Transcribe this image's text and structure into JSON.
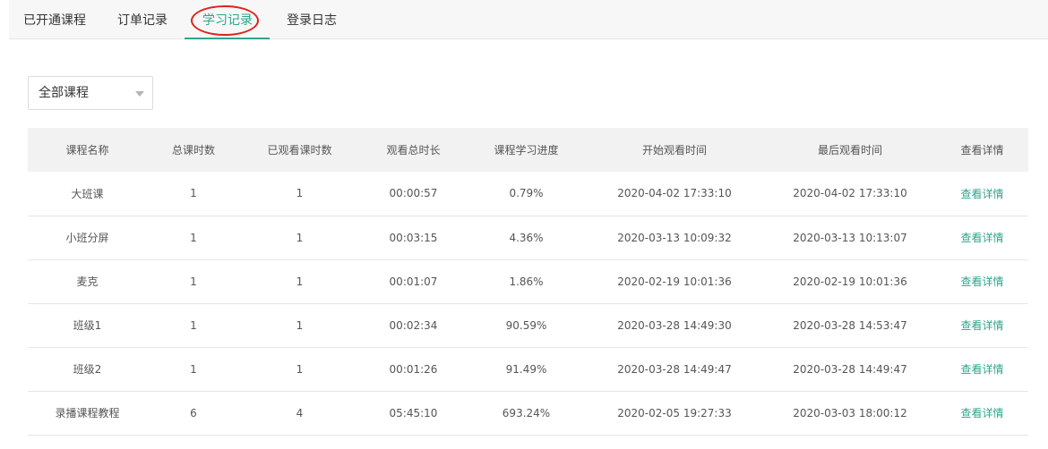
{
  "tabs": [
    {
      "label": "已开通课程"
    },
    {
      "label": "订单记录"
    },
    {
      "label": "学习记录"
    },
    {
      "label": "登录日志"
    }
  ],
  "filter": {
    "selected": "全部课程"
  },
  "table": {
    "headers": [
      "课程名称",
      "总课时数",
      "已观看课时数",
      "观看总时长",
      "课程学习进度",
      "开始观看时间",
      "最后观看时间",
      "查看详情"
    ],
    "rows": [
      {
        "name": "大班课",
        "total": "1",
        "watched": "1",
        "duration": "00:00:57",
        "progress": "0.79%",
        "start": "2020-04-02 17:33:10",
        "last": "2020-04-02 17:33:10",
        "action": "查看详情"
      },
      {
        "name": "小班分屏",
        "total": "1",
        "watched": "1",
        "duration": "00:03:15",
        "progress": "4.36%",
        "start": "2020-03-13 10:09:32",
        "last": "2020-03-13 10:13:07",
        "action": "查看详情"
      },
      {
        "name": "麦克",
        "total": "1",
        "watched": "1",
        "duration": "00:01:07",
        "progress": "1.86%",
        "start": "2020-02-19 10:01:36",
        "last": "2020-02-19 10:01:36",
        "action": "查看详情"
      },
      {
        "name": "班级1",
        "total": "1",
        "watched": "1",
        "duration": "00:02:34",
        "progress": "90.59%",
        "start": "2020-03-28 14:49:30",
        "last": "2020-03-28 14:53:47",
        "action": "查看详情"
      },
      {
        "name": "班级2",
        "total": "1",
        "watched": "1",
        "duration": "00:01:26",
        "progress": "91.49%",
        "start": "2020-03-28 14:49:47",
        "last": "2020-03-28 14:49:47",
        "action": "查看详情"
      },
      {
        "name": "录播课程教程",
        "total": "6",
        "watched": "4",
        "duration": "05:45:10",
        "progress": "693.24%",
        "start": "2020-02-05 19:27:33",
        "last": "2020-03-03 18:00:12",
        "action": "查看详情"
      }
    ]
  },
  "colors": {
    "accent": "#2ca58d",
    "highlight_circle": "#e0211d",
    "header_bg": "#f2f2f2",
    "tabbar_bg": "#f7f7f7"
  }
}
